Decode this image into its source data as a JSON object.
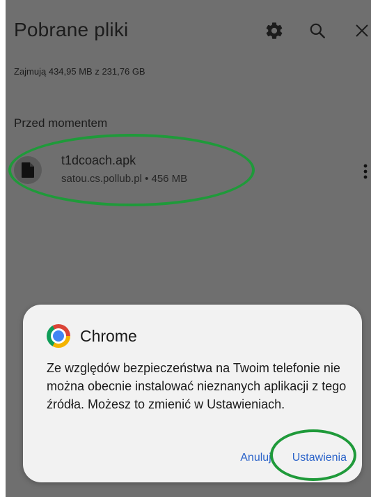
{
  "header": {
    "title": "Pobrane pliki",
    "icons": [
      "settings-icon",
      "search-icon",
      "close-icon"
    ]
  },
  "storage_info": "Zajmują 434,95 MB z 231,76 GB",
  "section": {
    "title": "Przed momentem"
  },
  "file": {
    "name": "t1dcoach.apk",
    "meta": "satou.cs.pollub.pl • 456 MB",
    "icon": "document-icon"
  },
  "dialog": {
    "app_name": "Chrome",
    "message": "Ze względów bezpieczeństwa na Twoim telefonie nie można obecnie instalować nieznanych aplikacji z tego źródła. Możesz to zmienić w Ustawieniach.",
    "cancel_label": "Anuluj",
    "settings_label": "Ustawienia"
  },
  "colors": {
    "background_dim": "#6f6f6f",
    "dialog_bg": "#f2f2f2",
    "accent_blue": "#2b63c9",
    "annotation_green": "#1f9a3a"
  }
}
